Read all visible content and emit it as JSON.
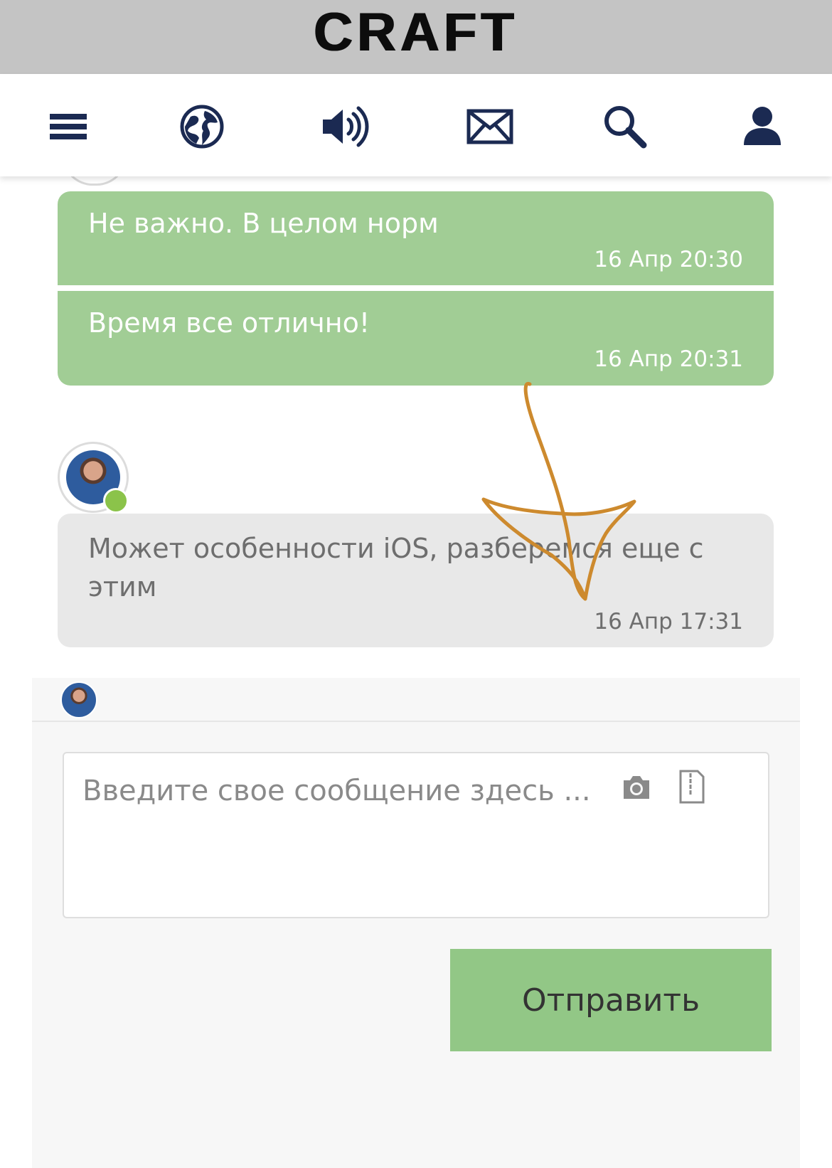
{
  "app": {
    "logo_text": "CRAFT"
  },
  "nav": {
    "icons": [
      "menu-icon",
      "globe-icon",
      "speaker-icon",
      "mail-icon",
      "search-icon",
      "user-icon"
    ],
    "icon_color": "#1b2a52"
  },
  "messages": [
    {
      "text": "Не важно. В целом норм",
      "time": "16 Апр 20:30",
      "side": "outgoing"
    },
    {
      "text": "Время все отлично!",
      "time": "16 Апр 20:31",
      "side": "outgoing"
    },
    {
      "text": "Может особенности iOS, разберемся еще с этим",
      "time": "16 Апр 17:31",
      "side": "incoming"
    }
  ],
  "composer": {
    "placeholder": "Введите свое сообщение здесь ...",
    "send_label": "Отправить"
  },
  "colors": {
    "outgoing_bubble": "#a1cd95",
    "incoming_bubble": "#e8e8e8",
    "send_button": "#92c786",
    "annotation": "#cd8a2e",
    "online": "#8bc34a"
  }
}
